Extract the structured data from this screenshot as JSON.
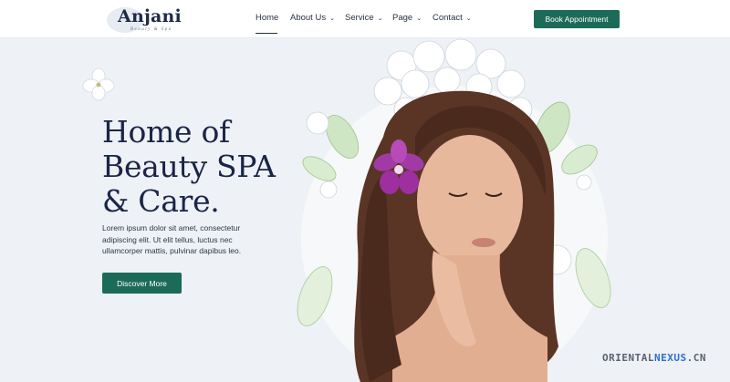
{
  "brand": {
    "name": "Anjani",
    "tagline": "Beauty & Spa"
  },
  "nav": {
    "items": [
      {
        "label": "Home",
        "active": true
      },
      {
        "label": "About Us",
        "dropdown": true
      },
      {
        "label": "Service",
        "dropdown": true
      },
      {
        "label": "Page",
        "dropdown": true
      },
      {
        "label": "Contact",
        "dropdown": true
      }
    ],
    "cta_label": "Book Appointment"
  },
  "hero": {
    "title_line1": "Home of",
    "title_line2": "Beauty SPA",
    "title_line3": "& Care.",
    "description": "Lorem ipsum dolor sit amet, consectetur adipiscing elit. Ut elit tellus, luctus nec ullamcorper mattis, pulvinar dapibus leo.",
    "button_label": "Discover More"
  },
  "watermark": {
    "part1": "ORIENTAL",
    "part2": "NEXUS",
    "part3": ".CN"
  },
  "colors": {
    "accent": "#1c6b58",
    "heading": "#1a2547",
    "background": "#eef1f5",
    "header_bg": "#ffffff"
  }
}
